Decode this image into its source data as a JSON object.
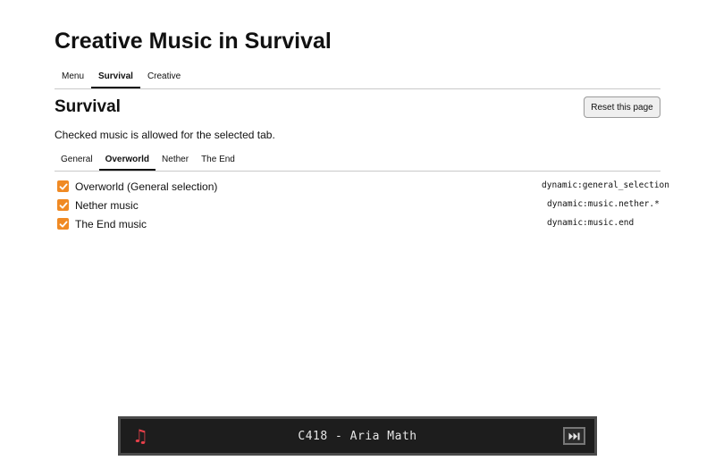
{
  "page": {
    "title": "Creative Music in Survival"
  },
  "top_tabs": [
    {
      "label": "Menu",
      "active": false
    },
    {
      "label": "Survival",
      "active": true
    },
    {
      "label": "Creative",
      "active": false
    }
  ],
  "section": {
    "title": "Survival",
    "reset_label": "Reset this page",
    "description": "Checked music is allowed for the selected tab."
  },
  "sub_tabs": [
    {
      "label": "General",
      "active": false
    },
    {
      "label": "Overworld",
      "active": true
    },
    {
      "label": "Nether",
      "active": false
    },
    {
      "label": "The End",
      "active": false
    }
  ],
  "music_items": [
    {
      "label": "Overworld (General selection)",
      "id": "dynamic:general_selection",
      "checked": true
    },
    {
      "label": "Nether music",
      "id": "dynamic:music.nether.*",
      "checked": true
    },
    {
      "label": "The End music",
      "id": "dynamic:music.end",
      "checked": true
    }
  ],
  "player": {
    "icon": "music-note-icon",
    "icon_glyph": "♫",
    "track": "C418 - Aria Math",
    "skip_icon": "skip-forward-icon"
  },
  "colors": {
    "accent": "#f08a24",
    "player_bg": "#1d1d1d",
    "note_icon": "#e8404a"
  }
}
